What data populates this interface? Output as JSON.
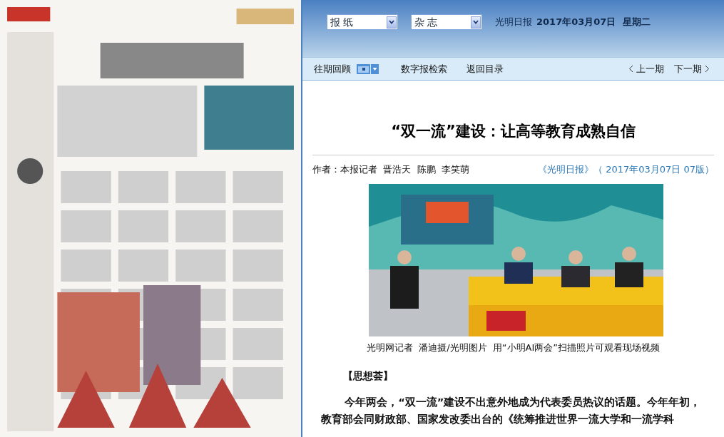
{
  "header": {
    "selects": [
      {
        "value": "报 纸"
      },
      {
        "value": "杂 志"
      }
    ],
    "paper_name": "光明日报",
    "date": "2017年03月07日",
    "weekday": "星期二"
  },
  "nav": {
    "archive": "往期回顾",
    "search": "数字报检索",
    "back": "返回目录",
    "prev": "上一期",
    "next": "下一期"
  },
  "article": {
    "title": "“双一流”建设：让高等教育成熟自信",
    "author": "作者：本报记者  晋浩天  陈鹏  李笑萌",
    "source": "《光明日报》（ 2017年03月07日 07版）",
    "caption": "光明网记者  潘迪摄/光明图片  用“小明AI两会”扫描照片可观看现场视频",
    "section": "【思想荟】",
    "paragraph": "今年两会，“双一流”建设不出意外地成为代表委员热议的话题。今年年初，教育部会同财政部、国家发改委出台的《统筹推进世界一流大学和一流学科"
  }
}
